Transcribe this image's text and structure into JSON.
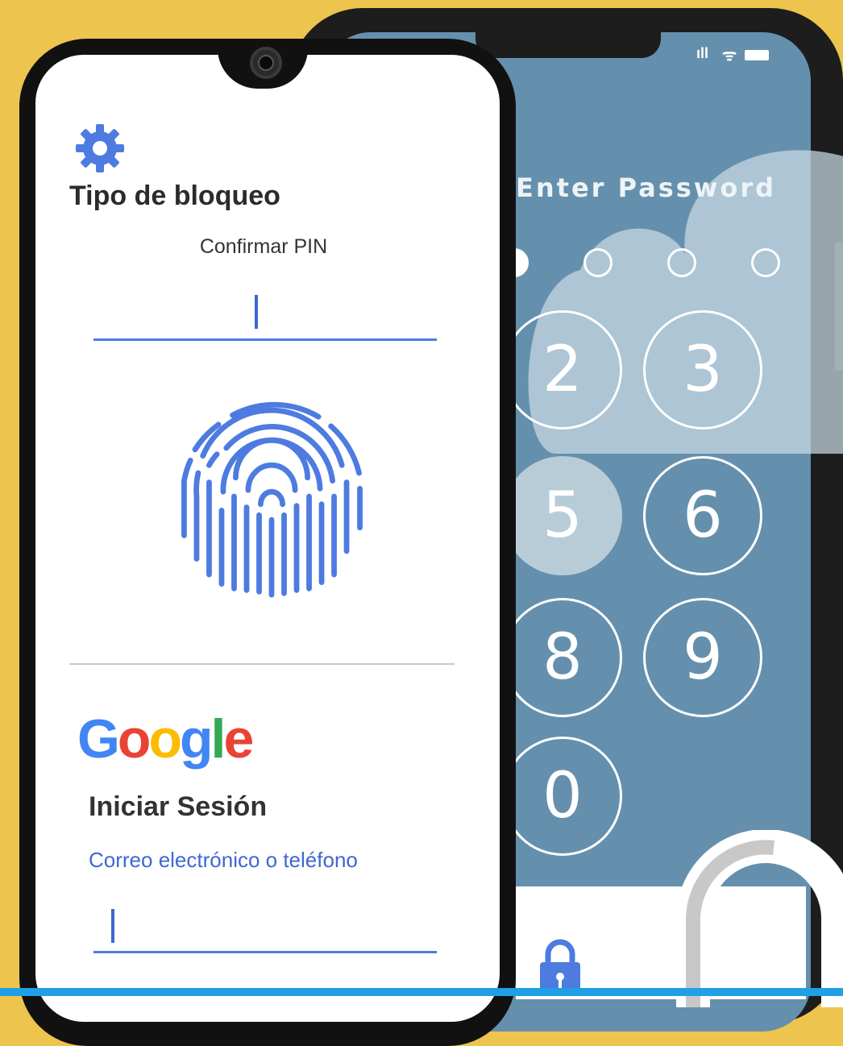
{
  "lock_screen": {
    "title": "Enter Password",
    "pin_dots": [
      true,
      false,
      false,
      false
    ],
    "keys": [
      "2",
      "3",
      "5",
      "6",
      "8",
      "9",
      "0"
    ],
    "pressed_key": "5",
    "status_icons": [
      "signal-icon",
      "wifi-icon",
      "battery-icon"
    ],
    "signal_glyph": "ıll",
    "wifi_glyph": "ᯤ",
    "background_color": "#6590AD"
  },
  "settings": {
    "title": "Tipo de bloqueo",
    "pin_label": "Confirmar PIN",
    "pin_value": "",
    "icon": "gear-icon",
    "accent_color": "#4D7BE0"
  },
  "google": {
    "logo_letters": [
      "G",
      "o",
      "o",
      "g",
      "l",
      "e"
    ],
    "logo_colors": [
      "#4285F4",
      "#EA4335",
      "#FBBC05",
      "#4285F4",
      "#34A853",
      "#EA4335"
    ],
    "signin_title": "Iniciar Sesión",
    "email_placeholder": "Correo electrónico o teléfono",
    "email_value": ""
  },
  "colors": {
    "background": "#EDC54E",
    "bottom_bar": "#1FA0E6"
  }
}
